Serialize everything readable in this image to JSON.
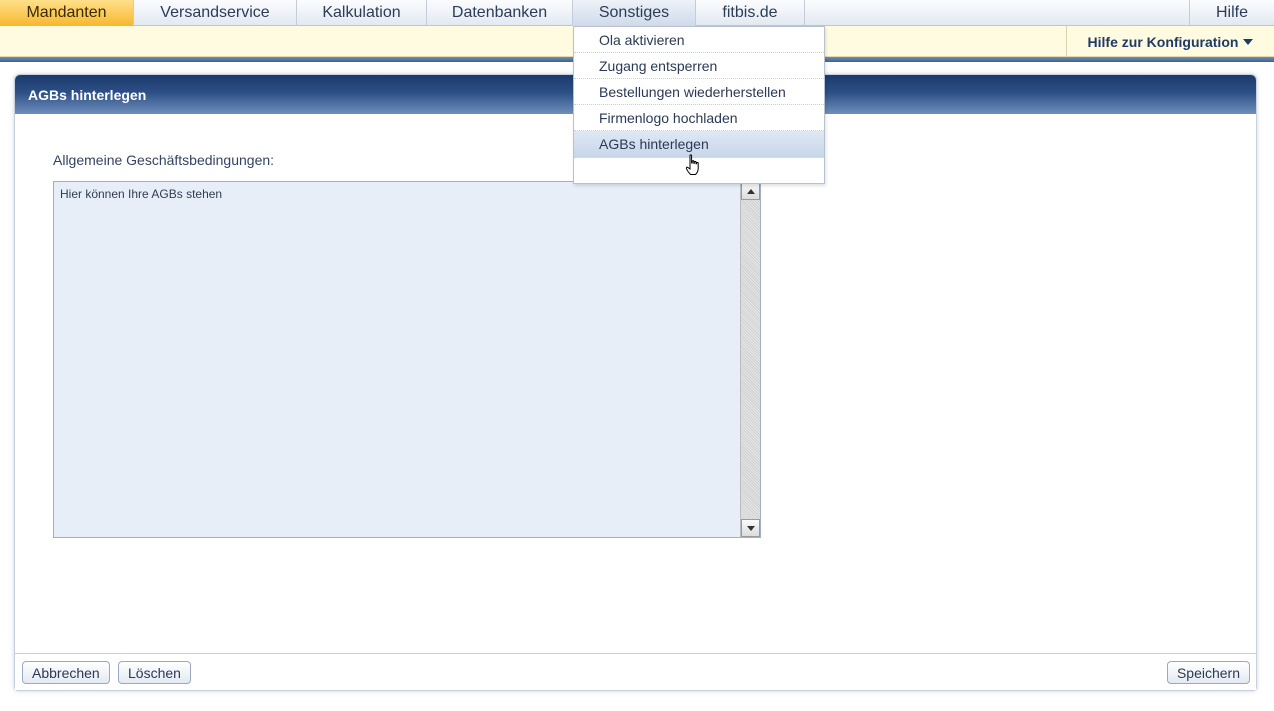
{
  "nav": {
    "items": [
      {
        "label": "Mandanten",
        "state": "active"
      },
      {
        "label": "Versandservice"
      },
      {
        "label": "Kalkulation"
      },
      {
        "label": "Datenbanken"
      },
      {
        "label": "Sonstiges",
        "state": "open"
      },
      {
        "label": "fitbis.de"
      }
    ],
    "help": "Hilfe"
  },
  "subbar": {
    "config_help": "Hilfe zur Konfiguration"
  },
  "dropdown": {
    "items": [
      "Ola aktivieren",
      "Zugang entsperren",
      "Bestellungen wiederherstellen",
      "Firmenlogo hochladen",
      "AGBs hinterlegen"
    ],
    "highlighted": "AGBs hinterlegen"
  },
  "panel": {
    "title": "AGBs hinterlegen",
    "field_label": "Allgemeine Geschäftsbedingungen:",
    "textarea_value": "Hier können Ihre AGBs stehen"
  },
  "footer": {
    "cancel": "Abbrechen",
    "delete": "Löschen",
    "save": "Speichern"
  },
  "colors": {
    "active_tab": "#f6b82d",
    "header_blue": "#1c3a6b",
    "subbar_bg": "#fffbe0",
    "textarea_bg": "#e8eef7"
  },
  "icons": [
    "caret-down-icon",
    "scroll-up-icon",
    "scroll-down-icon",
    "hand-pointer-cursor-icon"
  ]
}
